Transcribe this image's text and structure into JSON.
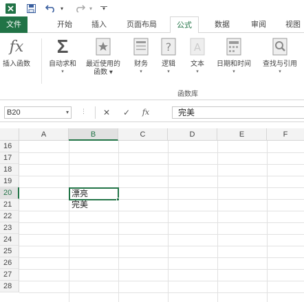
{
  "qat": {
    "undo_caret": "▾",
    "redo_caret": "▾",
    "customize": "▾"
  },
  "tabs": [
    {
      "label": "文件",
      "name": "tab-file"
    },
    {
      "label": "开始",
      "name": "tab-home"
    },
    {
      "label": "插入",
      "name": "tab-insert"
    },
    {
      "label": "页面布局",
      "name": "tab-page-layout"
    },
    {
      "label": "公式",
      "name": "tab-formulas"
    },
    {
      "label": "数据",
      "name": "tab-data"
    },
    {
      "label": "审阅",
      "name": "tab-review"
    },
    {
      "label": "视图",
      "name": "tab-view"
    }
  ],
  "ribbon": {
    "insert_function": "插入函数",
    "autosum": "自动求和",
    "recent": "最近使用的",
    "recent2": "函数",
    "financial": "财务",
    "logical": "逻辑",
    "text": "文本",
    "datetime": "日期和时间",
    "lookup": "查找与引用",
    "caret": "▾",
    "group_label": "函数库",
    "fx_glyph": "fx",
    "sigma_glyph": "Σ"
  },
  "formula_bar": {
    "name_box": "B20",
    "name_caret": "▾",
    "dots": "⋮",
    "cancel": "✕",
    "enter": "✓",
    "fx": "fx",
    "content": "完美"
  },
  "grid": {
    "columns": [
      "A",
      "B",
      "C",
      "D",
      "E",
      "F"
    ],
    "rows": [
      "16",
      "17",
      "18",
      "19",
      "20",
      "21",
      "22",
      "23",
      "24",
      "25",
      "26",
      "27",
      "28"
    ],
    "selected_column": "B",
    "selected_row": "20",
    "cells": {
      "B20": "漂亮",
      "B21": "完美"
    }
  },
  "colors": {
    "accent": "#217346"
  }
}
